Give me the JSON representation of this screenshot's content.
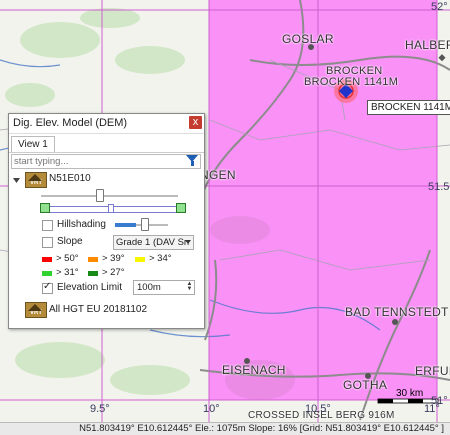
{
  "map": {
    "labels": {
      "goslar": "GOSLAR",
      "halbers": "HALBERS",
      "brocken": "BROCKEN",
      "brocken_elev": "BROCKEN 1141M",
      "ngen": "NGEN",
      "bad_tennstedt": "BAD TENNSTEDT",
      "eisenach": "EISENACH",
      "gotha": "GOTHA",
      "erfur": "ERFUR",
      "crossed": "CROSSED INSEL BERG 916M"
    },
    "coords": {
      "lat_52": "52°",
      "lat_515": "51.5°",
      "lat_51": "51°",
      "lon_95": "9.5°",
      "lon_10": "10°",
      "lon_105": "10.5°",
      "lon_11": "11°"
    },
    "tooltip": "BROCKEN 1141M",
    "scale": "30 km",
    "dem_overlay_color": "#ff40ff"
  },
  "panel": {
    "title": "Dig. Elev. Model (DEM)",
    "close": "x",
    "tab": "View 1",
    "filter_placeholder": "start typing...",
    "layer1": {
      "name": "N51E010",
      "icon": "VRT",
      "opacity": 0.42,
      "range_min": 0.0,
      "range_max": 1.0
    },
    "hillshading": {
      "label": "Hillshading",
      "checked": false,
      "value": 0.55
    },
    "slope": {
      "label": "Slope",
      "checked": false,
      "grade": "Grade 1 (DAV Sn"
    },
    "legend": [
      {
        "label": "> 50°",
        "color": "#ff0000"
      },
      {
        "label": "> 39°",
        "color": "#ff8a00"
      },
      {
        "label": "> 34°",
        "color": "#f7f700"
      },
      {
        "label": "> 31°",
        "color": "#2fd22f"
      },
      {
        "label": "> 27°",
        "color": "#178a17"
      }
    ],
    "elevation_limit": {
      "label": "Elevation Limit",
      "checked": true,
      "value": "100m"
    },
    "layer2": {
      "name": "All HGT EU 20181102",
      "icon": "VRT"
    }
  },
  "statusbar": {
    "text": "N51.803419° E10.612445° Ele.: 1075m Slope: 16% [Grid: N51.803419° E10.612445° ]"
  }
}
